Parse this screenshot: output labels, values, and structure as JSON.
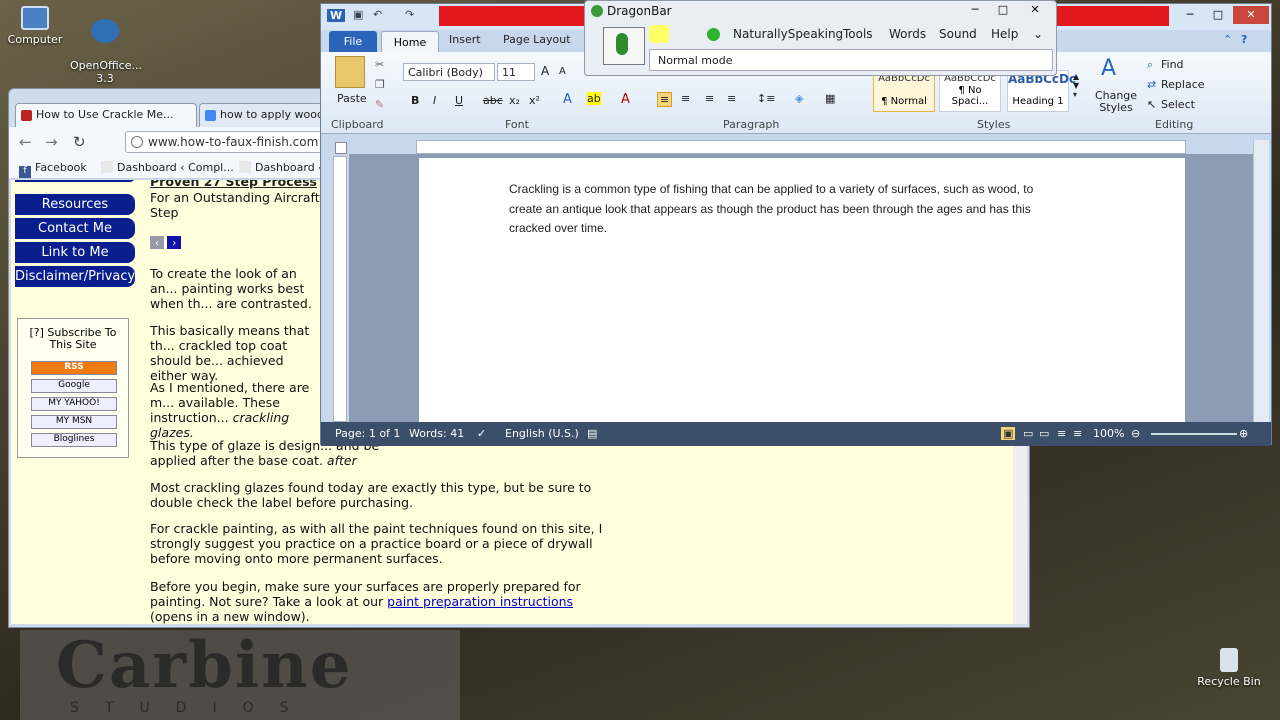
{
  "desktop": {
    "icons": [
      {
        "label": "Computer"
      },
      {
        "label": "OpenOffice...\n3.3"
      },
      {
        "label": "Recycle Bin"
      }
    ],
    "wallpaper_text": "Carbine",
    "wallpaper_sub": "STUDIOS"
  },
  "browser": {
    "tabs": [
      {
        "label": "How to Use Crackle Me..."
      },
      {
        "label": "how to apply wood"
      }
    ],
    "url": "www.how-to-faux-finish.com",
    "bookmarks": [
      "Facebook",
      "Dashboard ‹ Compl...",
      "Dashboard ‹"
    ],
    "sidebar_links": [
      "Resources",
      "Contact Me",
      "Link to Me",
      "Disclaimer/Privacy"
    ],
    "subscribe": {
      "help": "[?]",
      "title": "Subscribe To This Site",
      "feeds": [
        "RSS",
        "Google",
        "MY YAHOO!",
        "MY MSN",
        "Bloglines"
      ]
    },
    "headline": "Proven 27 Step Process",
    "subheadline": "For an Outstanding Aircraft Step",
    "paragraphs": [
      "To create the look of an an... painting works best when th... are contrasted.",
      "This basically means that th... crackled top coat should be... achieved either way.",
      "As I mentioned, there are m... available. These instruction...",
      "This type of glaze is design... and be applied after the base coat.",
      "Most crackling glazes found today are exactly this type, but be sure to double check the label before purchasing.",
      "For crackle painting, as with all the paint techniques found on this site, I strongly suggest you practice on a practice board or a piece of drywall before moving onto more permanent surfaces.",
      "Before you begin, make sure your surfaces are properly prepared for painting. Not sure? Take a look at our"
    ],
    "p3_italic": "crackling glazes.",
    "p4_italic": "after",
    "link_text": "paint preparation instructions",
    "link_after": "(opens in a new window)."
  },
  "word": {
    "tabs": [
      "File",
      "Home",
      "Insert",
      "Page Layout"
    ],
    "font": "Calibri (Body)",
    "size": "11",
    "groups": [
      "Clipboard",
      "Font",
      "Paragraph",
      "Styles",
      "Editing"
    ],
    "paste": "Paste",
    "styles": [
      "¶ Normal",
      "¶ No Spaci...",
      "Heading 1"
    ],
    "style_preview": "AaBbCcDc",
    "change_styles": "Change Styles",
    "editing": [
      "Find",
      "Replace",
      "Select"
    ],
    "document_text": "Crackling is a common type of fishing that can be applied to a variety of surfaces, such as wood, to create an antique look that appears as though the product has been through the ages and has this cracked over time.",
    "status": {
      "page": "Page: 1 of 1",
      "words": "Words: 41",
      "language": "English (U.S.)",
      "zoom": "100%"
    }
  },
  "dragon": {
    "title": "DragonBar",
    "menu": [
      "NaturallySpeaking",
      "Tools",
      "Words",
      "Sound",
      "Help"
    ],
    "mode": "Normal mode"
  }
}
